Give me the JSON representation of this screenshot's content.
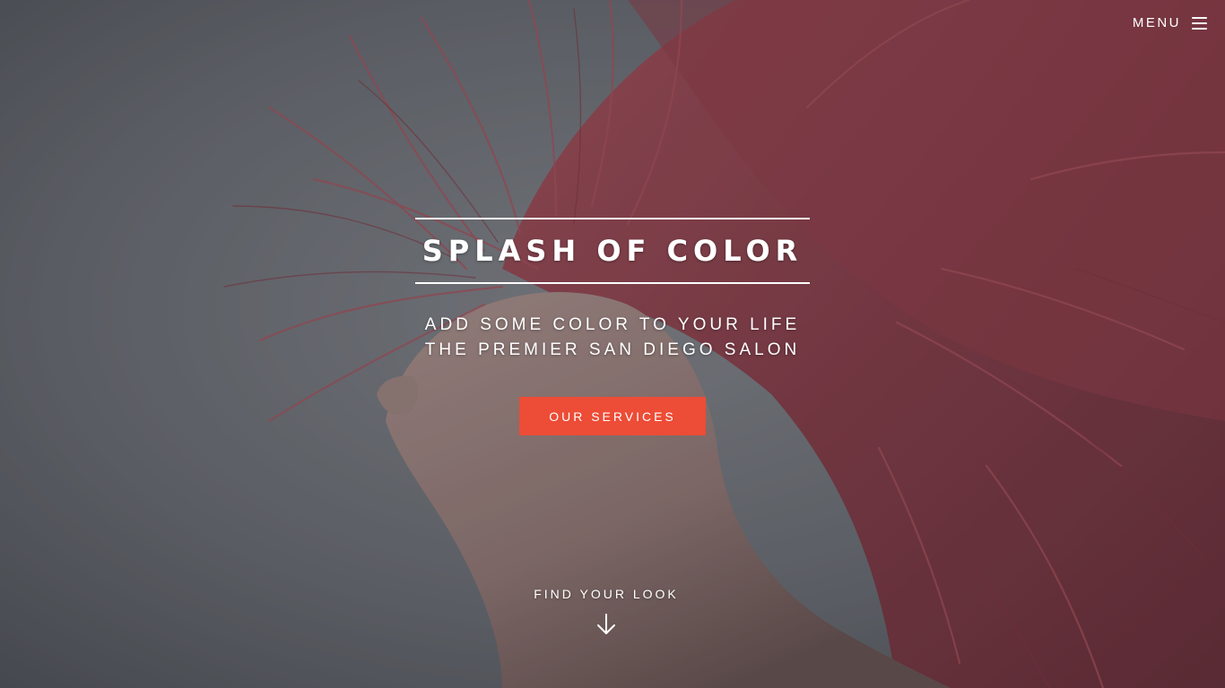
{
  "header": {
    "menu_label": "MENU",
    "menu_icon": "hamburger-menu-icon"
  },
  "hero": {
    "title": "SPLASH OF COLOR",
    "tagline_lines": [
      "ADD SOME COLOR TO YOUR LIFE",
      "THE PREMIER SAN DIEGO SALON"
    ],
    "cta_label": "OUR SERVICES",
    "scroll_label": "FIND YOUR LOOK",
    "scroll_icon": "arrow-down-icon",
    "background_image": "woman-with-flying-red-hair-photo"
  },
  "colors": {
    "accent": "#ed4c36",
    "text": "#ffffff",
    "background": "#6b6e73",
    "hair": "#a8414c"
  }
}
